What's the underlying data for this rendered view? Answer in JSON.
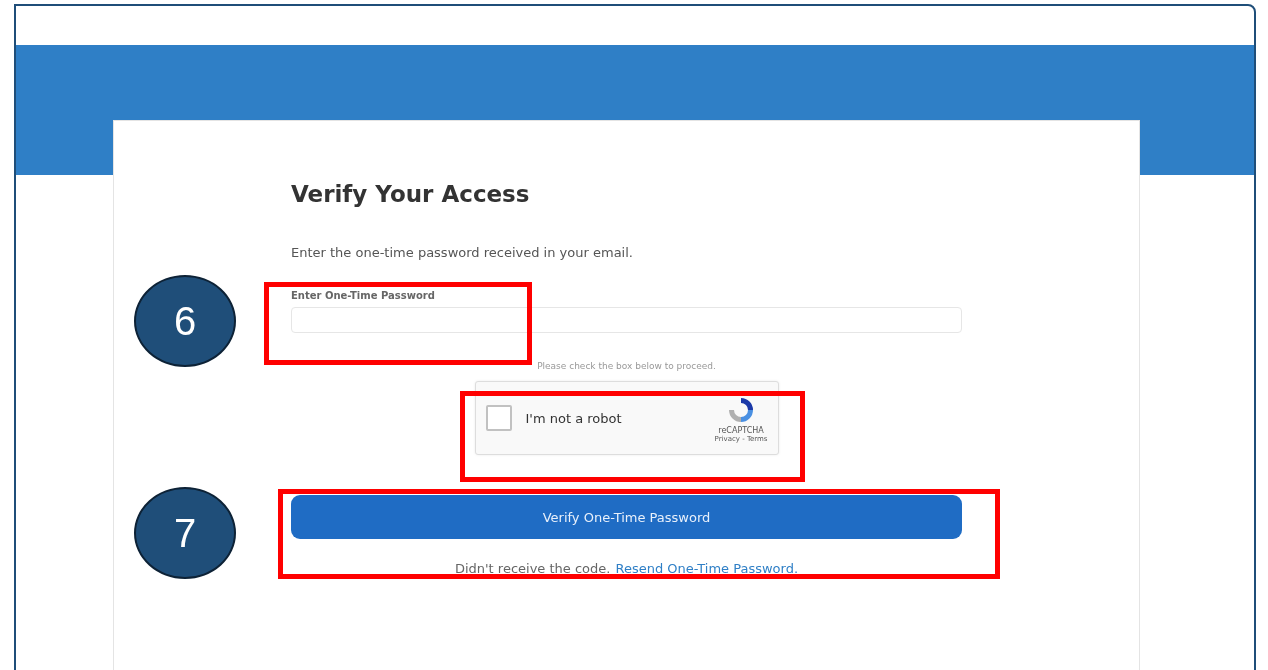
{
  "form": {
    "title": "Verify Your Access",
    "instruction": "Enter the one-time password received in your email.",
    "otp_field": {
      "label": "Enter One-Time Password"
    },
    "hint": "Please check the box below to proceed.",
    "captcha": {
      "label": "I'm not a robot",
      "checked": false,
      "brand": "reCAPTCHA",
      "links": "Privacy - Terms"
    },
    "verify_button": "Verify One-Time Password",
    "footer": {
      "text": "Didn't receive the code.",
      "link": "Resend One-Time Password."
    }
  },
  "callouts": [
    {
      "number": "6"
    },
    {
      "number": "7"
    }
  ]
}
